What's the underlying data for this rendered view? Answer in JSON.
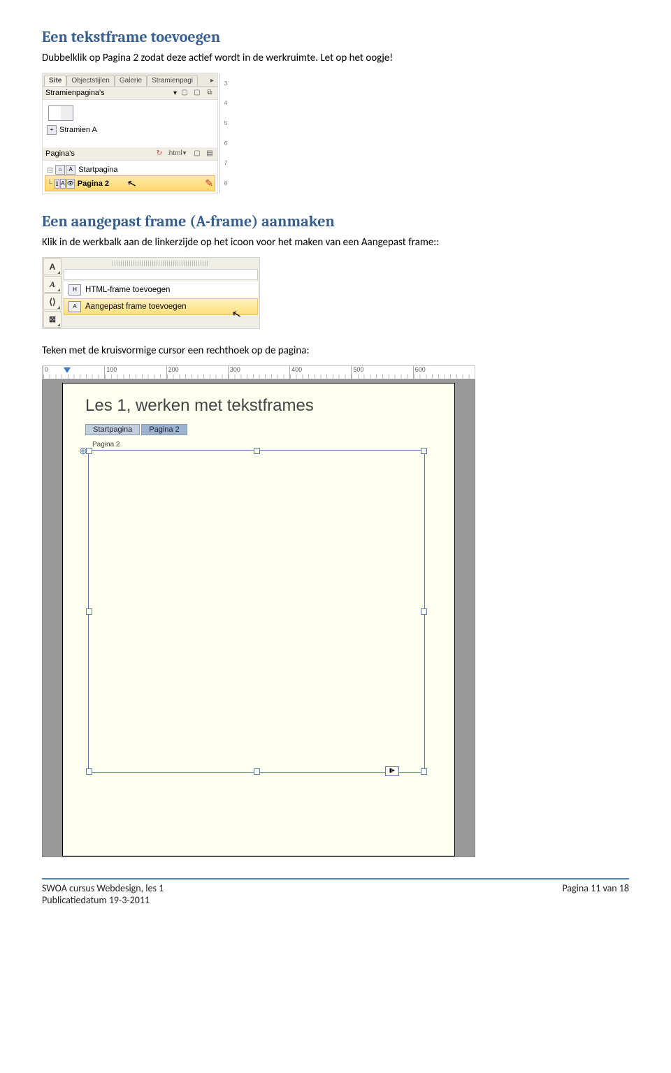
{
  "heading1": "Een tekstframe toevoegen",
  "para1": "Dubbelklik op Pagina 2 zodat deze actief wordt in de werkruimte. Let op het oogje!",
  "panel1": {
    "tabs": [
      "Site",
      "Objectstijlen",
      "Galerie",
      "Stramienpagi"
    ],
    "stramien_header": "Stramienpagina's",
    "stramien_item": "Stramien A",
    "paginas_header": "Pagina's",
    "html_label": ".html",
    "page_rows": [
      {
        "name": "Startpagina",
        "selected": false
      },
      {
        "name": "Pagina 2",
        "selected": true
      }
    ],
    "ruler_ticks": [
      "3",
      "4",
      "5",
      "6",
      "7",
      "8"
    ]
  },
  "heading2": "Een aangepast frame (A-frame) aanmaken",
  "para2": "Klik in de werkbalk aan de linkerzijde op het icoon voor het maken van een Aangepast frame::",
  "flyout": {
    "tools": [
      "A",
      "A",
      "⟨⟩",
      "⊠"
    ],
    "items": [
      {
        "label": "HTML-frame toevoegen",
        "selected": false
      },
      {
        "label": "Aangepast frame toevoegen",
        "selected": true
      }
    ]
  },
  "para3": "Teken met de kruisvormige cursor een rechthoek op de pagina:",
  "canvas": {
    "ruler_values": [
      "0",
      "100",
      "200",
      "300",
      "400",
      "500",
      "600"
    ],
    "doc_title": "Les 1, werken met tekstframes",
    "crumbs": [
      {
        "label": "Startpagina",
        "active": false
      },
      {
        "label": "Pagina 2",
        "active": true
      }
    ],
    "page_label_text": "Pagina 2"
  },
  "footer": {
    "course": "SWOA cursus Webdesign, les 1",
    "pubdate": "Publicatiedatum 19-3-2011",
    "page": "Pagina 11 van 18"
  }
}
